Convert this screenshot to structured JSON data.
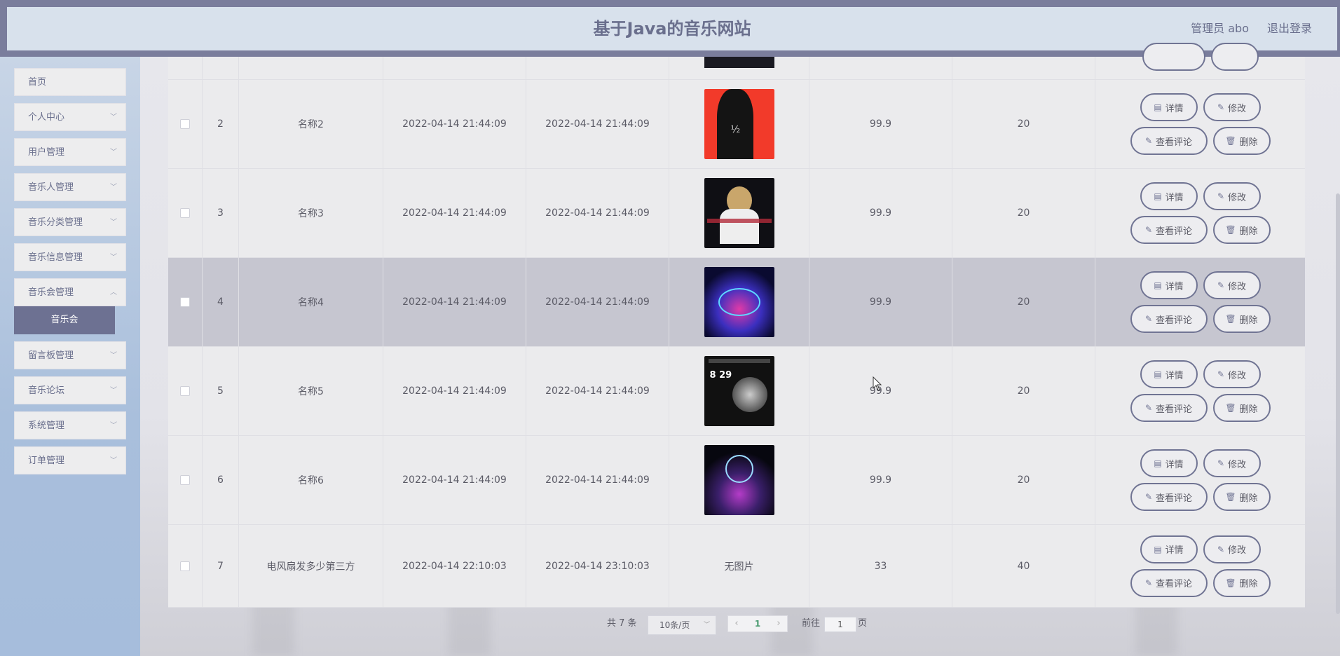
{
  "header": {
    "title": "基于Java的音乐网站",
    "admin": "管理员 abo",
    "logout": "退出登录"
  },
  "sidebar": {
    "items": [
      {
        "label": "首页",
        "has_children": false
      },
      {
        "label": "个人中心",
        "has_children": true
      },
      {
        "label": "用户管理",
        "has_children": true
      },
      {
        "label": "音乐人管理",
        "has_children": true
      },
      {
        "label": "音乐分类管理",
        "has_children": true
      },
      {
        "label": "音乐信息管理",
        "has_children": true
      },
      {
        "label": "音乐会管理",
        "has_children": true
      },
      {
        "label": "留言板管理",
        "has_children": true
      },
      {
        "label": "音乐论坛",
        "has_children": true
      },
      {
        "label": "系统管理",
        "has_children": true
      },
      {
        "label": "订单管理",
        "has_children": true
      }
    ],
    "active_sub": "音乐会"
  },
  "table": {
    "rows": [
      {
        "index": "2",
        "name": "名称2",
        "start": "2022-04-14 21:44:09",
        "end": "2022-04-14 21:44:09",
        "image": "thumb-red",
        "price": "99.9",
        "count": "20"
      },
      {
        "index": "3",
        "name": "名称3",
        "start": "2022-04-14 21:44:09",
        "end": "2022-04-14 21:44:09",
        "image": "thumb-singer",
        "price": "99.9",
        "count": "20"
      },
      {
        "index": "4",
        "name": "名称4",
        "start": "2022-04-14 21:44:09",
        "end": "2022-04-14 21:44:09",
        "image": "thumb-neon",
        "price": "99.9",
        "count": "20"
      },
      {
        "index": "5",
        "name": "名称5",
        "start": "2022-04-14 21:44:09",
        "end": "2022-04-14 21:44:09",
        "image": "thumb-poster",
        "price": "99.9",
        "count": "20"
      },
      {
        "index": "6",
        "name": "名称6",
        "start": "2022-04-14 21:44:09",
        "end": "2022-04-14 21:44:09",
        "image": "thumb-stage",
        "price": "99.9",
        "count": "20"
      },
      {
        "index": "7",
        "name": "电风扇发多少第三方",
        "start": "2022-04-14 22:10:03",
        "end": "2022-04-14 23:10:03",
        "image_text": "无图片",
        "price": "33",
        "count": "40"
      }
    ],
    "actions": {
      "detail": "详情",
      "edit": "修改",
      "comments": "查看评论",
      "delete": "删除"
    }
  },
  "pagination": {
    "total": "共 7 条",
    "page_size": "10条/页",
    "current": "1",
    "goto_label": "前往",
    "goto_value": "1",
    "unit": "页"
  },
  "colors": {
    "accent": "#707493",
    "header_bg": "#d8e1ec",
    "highlight_row": "#c6c6d0"
  }
}
